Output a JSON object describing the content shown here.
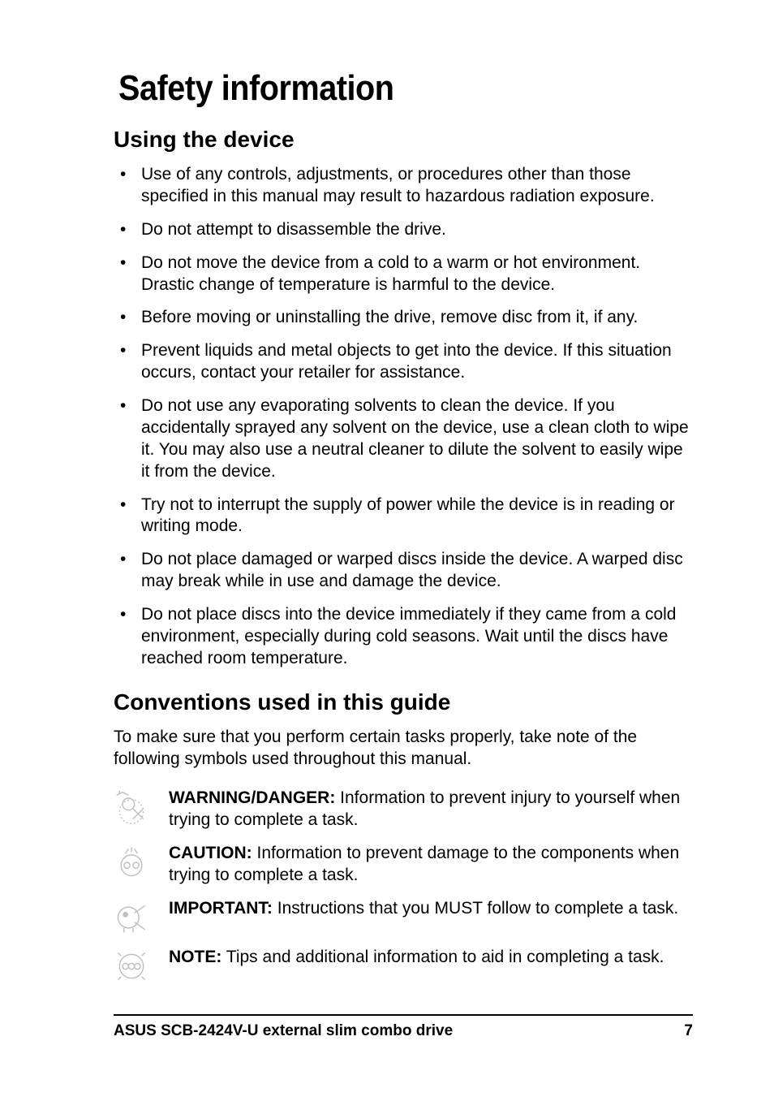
{
  "title": "Safety information",
  "section1": {
    "heading": "Using the device",
    "items": [
      "Use of any controls, adjustments, or procedures other than those specified in this manual may result to hazardous radiation exposure.",
      "Do not attempt to disassemble the drive.",
      "Do not move the device from a cold to a warm or hot environment. Drastic change of temperature is harmful to the device.",
      "Before moving or uninstalling the drive, remove disc from it, if any.",
      "Prevent liquids and metal objects to get into the device. If this situation occurs, contact your retailer for assistance.",
      "Do not use any evaporating solvents to clean the device. If you accidentally sprayed any solvent on the device, use a clean cloth to wipe it. You may also use a neutral cleaner to dilute the solvent to easily wipe it from the device.",
      "Try not to interrupt the supply of power while the device is in reading or writing mode.",
      "Do not place damaged or warped discs inside the device. A warped disc may break while in use and damage the device.",
      "Do not place discs into the device immediately if they came from a cold environment, especially during cold seasons. Wait until the discs have reached room temperature."
    ]
  },
  "section2": {
    "heading": "Conventions used in this guide",
    "intro": "To make sure that you perform certain tasks properly, take note of the following symbols used throughout this manual.",
    "legend": [
      {
        "label": "WARNING/DANGER:",
        "text": " Information to prevent injury to yourself when trying to complete a task.",
        "icon": "warning-icon"
      },
      {
        "label": "CAUTION:",
        "text": " Information to prevent damage to the components when trying to complete a task.",
        "icon": "caution-icon"
      },
      {
        "label": "IMPORTANT:",
        "text": " Instructions that you MUST follow to complete a task.",
        "icon": "important-icon"
      },
      {
        "label": "NOTE:",
        "text": " Tips and additional information to aid in completing a task.",
        "icon": "note-icon"
      }
    ]
  },
  "footer": {
    "product": "ASUS SCB-2424V-U external slim combo drive",
    "page": "7"
  }
}
